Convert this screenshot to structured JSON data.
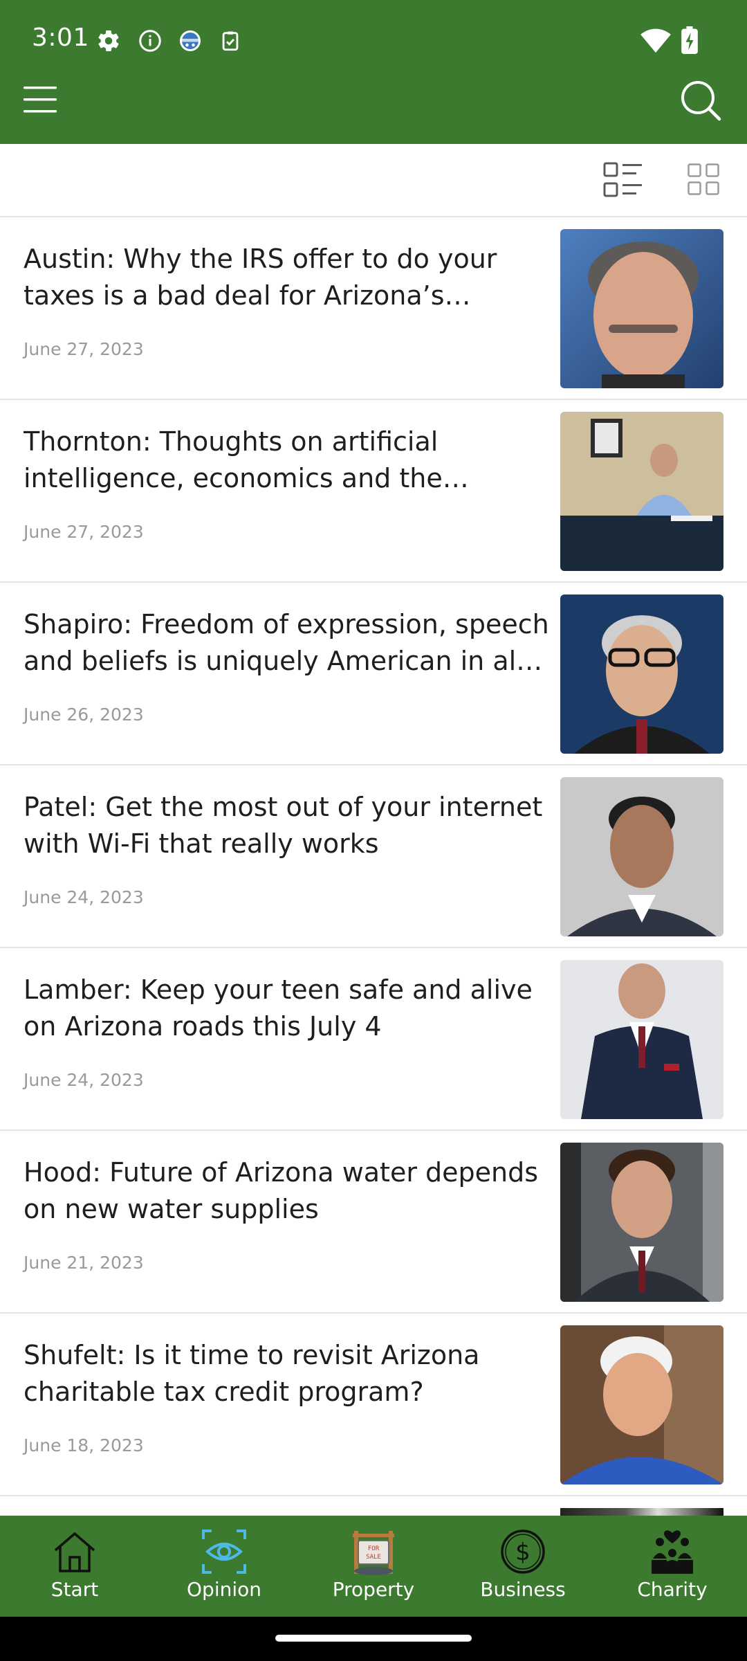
{
  "status_bar": {
    "time": "3:01",
    "icons": [
      "gear-icon",
      "info-icon",
      "globe-badge-icon",
      "clipboard-check-icon",
      "wifi-icon",
      "battery-charging-icon"
    ]
  },
  "app_bar": {
    "menu_icon": "hamburger-menu-icon",
    "search_icon": "search-icon"
  },
  "view_toggle": {
    "list_icon": "list-view-icon",
    "grid_icon": "grid-view-icon",
    "selected": "list"
  },
  "articles": [
    {
      "title": "Austin: Why the IRS offer to do your taxes is a bad deal for Arizona’s Hispa…",
      "date": "June 27, 2023"
    },
    {
      "title": "Thornton: Thoughts on artificial intelligence, economics and the future…",
      "date": "June 27, 2023"
    },
    {
      "title": "Shapiro: Freedom of expression, speech and beliefs is uniquely American in all f…",
      "date": "June 26, 2023"
    },
    {
      "title": "Patel: Get the most out of your internet with Wi-Fi that really works",
      "date": "June 24, 2023"
    },
    {
      "title": "Lamber: Keep your teen safe and alive on Arizona roads this July 4",
      "date": "June 24, 2023"
    },
    {
      "title": "Hood: Future of Arizona water depends on new water supplies",
      "date": "June 21, 2023"
    },
    {
      "title": "Shufelt: Is it time to revisit Arizona charitable tax credit program?",
      "date": "June 18, 2023"
    }
  ],
  "bottom_nav": [
    {
      "label": "Start",
      "icon": "house-icon"
    },
    {
      "label": "Opinion",
      "icon": "eye-icon"
    },
    {
      "label": "Property",
      "icon": "for-sale-sign-icon",
      "sign_text": "FOR SALE"
    },
    {
      "label": "Business",
      "icon": "dollar-coin-icon"
    },
    {
      "label": "Charity",
      "icon": "people-heart-icon"
    }
  ],
  "colors": {
    "brand_green": "#3b7a2f",
    "opinion_accent": "#4fb9e6",
    "divider": "#dfe6ee",
    "date_gray": "#9a9a9a"
  }
}
